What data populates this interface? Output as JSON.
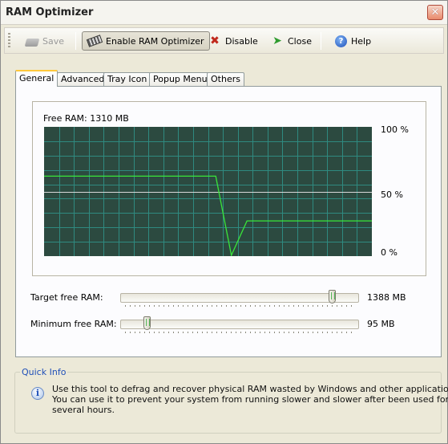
{
  "window": {
    "title": "RAM Optimizer",
    "close_glyph": "✕"
  },
  "toolbar": {
    "save_label": "Save",
    "enable_label": "Enable RAM Optimizer",
    "disable_label": "Disable",
    "close_label": "Close",
    "help_label": "Help",
    "icons": {
      "save": "disk-icon",
      "enable": "ram-chip-icon",
      "disable": "red-cross-icon",
      "close": "green-exit-icon",
      "help": "help-icon"
    }
  },
  "tabs": [
    {
      "label": "General",
      "active": true
    },
    {
      "label": "Advanced",
      "active": false
    },
    {
      "label": "Tray Icon",
      "active": false
    },
    {
      "label": "Popup Menu",
      "active": false
    },
    {
      "label": "Others",
      "active": false
    }
  ],
  "graph": {
    "free_ram_text": "Free RAM: 1310 MB",
    "label_100": "100 %",
    "label_50": "50 %",
    "label_0": "0 %",
    "background_color": "#2c4a40",
    "grid_color": "#2f8a80",
    "line_color": "#39e639",
    "midline_color": "#d8d8d8"
  },
  "chart_data": {
    "type": "line",
    "ylim": [
      0,
      100
    ],
    "series": [
      {
        "values": [
          62,
          62,
          62,
          62,
          62,
          62,
          62,
          62,
          62,
          62,
          62,
          62,
          0,
          27,
          27,
          27,
          27,
          27,
          27,
          27,
          27,
          27
        ]
      }
    ]
  },
  "sliders": {
    "target": {
      "label": "Target free RAM:",
      "value": "1388 MB",
      "position": 0.9
    },
    "minimum": {
      "label": "Minimum free RAM:",
      "value": "95 MB",
      "position": 0.1
    }
  },
  "quick_info": {
    "legend": "Quick Info",
    "lines": [
      "Use this tool to defrag and recover physical RAM wasted by Windows and other applications.",
      "You can use it to prevent your system from running slower and slower after been used for",
      "several hours."
    ]
  }
}
